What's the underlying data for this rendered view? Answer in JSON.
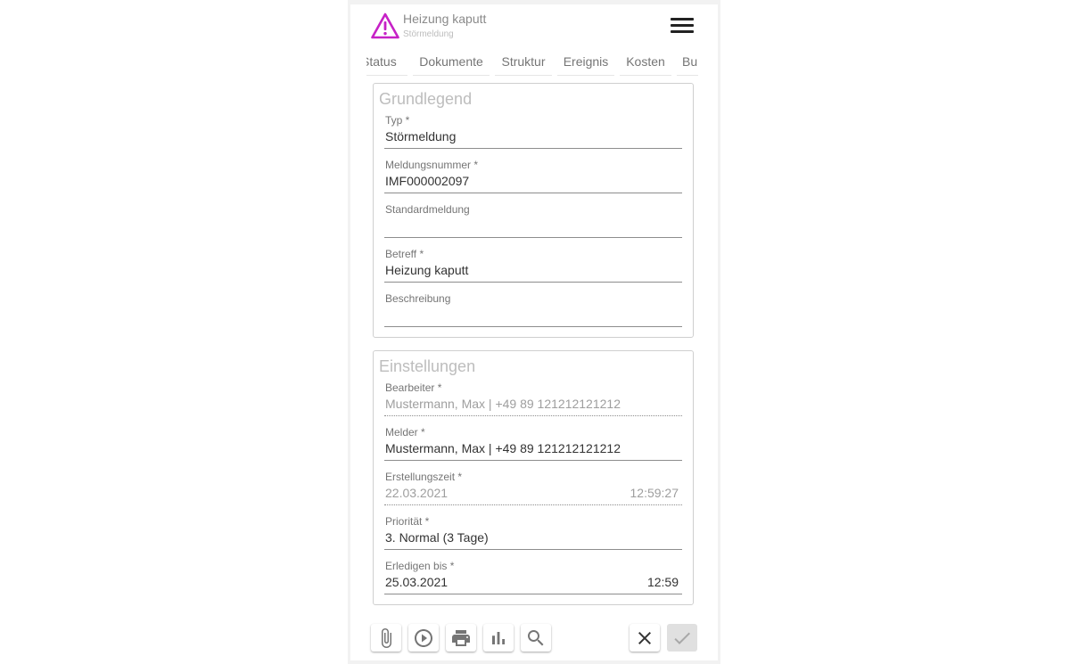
{
  "header": {
    "title": "Heizung kaputt",
    "subtitle": "Störmeldung",
    "warning_color": "#c621c6"
  },
  "tabs": [
    {
      "label": "Status"
    },
    {
      "label": "Dokumente"
    },
    {
      "label": "Struktur"
    },
    {
      "label": "Ereignis"
    },
    {
      "label": "Kosten"
    },
    {
      "label": "Bu"
    }
  ],
  "grundlegend": {
    "title": "Grundlegend",
    "typ": {
      "label": "Typ *",
      "value": "Störmeldung"
    },
    "meldungsnummer": {
      "label": "Meldungsnummer *",
      "value": "IMF000002097"
    },
    "standardmeldung": {
      "label": "Standardmeldung",
      "value": ""
    },
    "betreff": {
      "label": "Betreff *",
      "value": "Heizung kaputt"
    },
    "beschreibung": {
      "label": "Beschreibung",
      "value": ""
    }
  },
  "einstellungen": {
    "title": "Einstellungen",
    "bearbeiter": {
      "label": "Bearbeiter *",
      "value": "Mustermann, Max | +49 89 121212121212"
    },
    "melder": {
      "label": "Melder *",
      "value": "Mustermann, Max | +49 89 121212121212"
    },
    "erstellungszeit": {
      "label": "Erstellungszeit *",
      "date": "22.03.2021",
      "time": "12:59:27"
    },
    "prioritaet": {
      "label": "Priorität *",
      "value": "3. Normal (3 Tage)"
    },
    "erledigen_bis": {
      "label": "Erledigen bis *",
      "date": "25.03.2021",
      "time": "12:59"
    }
  },
  "toolbar": {
    "icons": [
      "paperclip-icon",
      "play-circle-icon",
      "printer-icon",
      "bar-chart-icon",
      "search-icon",
      "close-icon",
      "check-icon"
    ]
  }
}
